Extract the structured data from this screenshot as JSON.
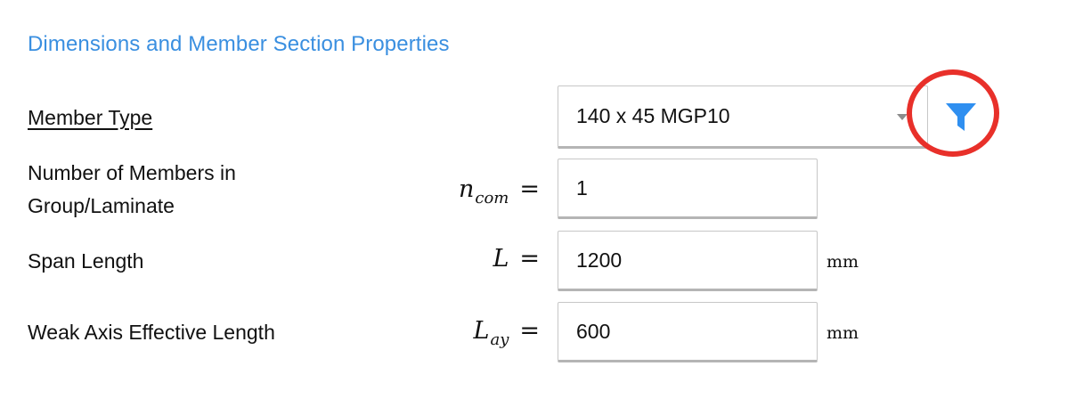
{
  "section": {
    "title": "Dimensions and Member Section Properties"
  },
  "member_type": {
    "label": "Member Type",
    "selected_value": "140 x 45 MGP10",
    "filter_icon": "filter-icon",
    "filter_color": "#2f8ff0",
    "highlight_color": "#e8302a"
  },
  "num_members": {
    "label_line1": "Number of Members in",
    "label_line2": "Group/Laminate",
    "symbol": "n",
    "subscript": "com",
    "equals": "=",
    "value": "1"
  },
  "span_length": {
    "label": "Span Length",
    "symbol": "L",
    "equals": "=",
    "value": "1200",
    "unit": "mm"
  },
  "weak_axis": {
    "label": "Weak Axis Effective Length",
    "symbol": "L",
    "subscript": "ay",
    "equals": "=",
    "value": "600",
    "unit": "mm"
  },
  "colors": {
    "title": "#3a8fe0",
    "text": "#111111",
    "border": "#c7c7c7"
  }
}
